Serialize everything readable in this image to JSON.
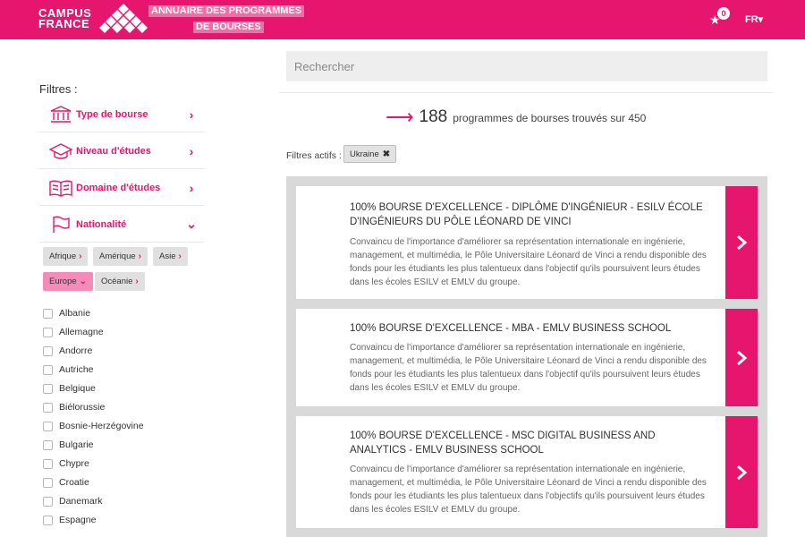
{
  "header": {
    "logo_line1": "CAMPUS",
    "logo_line2": "FRANCE",
    "tagline_line1": "ANNUAIRE DES PROGRAMMES",
    "tagline_line2": "DE BOURSES",
    "favorites_count": "0",
    "language": "FR▾",
    "brand_color": "#e6166e"
  },
  "sidebar": {
    "title": "Filtres :",
    "filters": [
      {
        "label": "Type de bourse",
        "icon": "institution-icon",
        "state": "collapsed"
      },
      {
        "label": "Niveau d'études",
        "icon": "graduation-cap-icon",
        "state": "collapsed"
      },
      {
        "label": "Domaine d'études",
        "icon": "book-icon",
        "state": "collapsed"
      },
      {
        "label": "Nationalité",
        "icon": "flag-icon",
        "state": "expanded"
      }
    ],
    "regions": [
      {
        "label": "Afrique",
        "active": false
      },
      {
        "label": "Amérique",
        "active": false
      },
      {
        "label": "Asie",
        "active": false
      },
      {
        "label": "Europe",
        "active": true
      },
      {
        "label": "Océanie",
        "active": false
      }
    ],
    "countries": [
      "Albanie",
      "Allemagne",
      "Andorre",
      "Autriche",
      "Belgique",
      "Biélorussie",
      "Bosnie-Herzégovine",
      "Bulgarie",
      "Chypre",
      "Croatie",
      "Danemark",
      "Espagne"
    ]
  },
  "main": {
    "search_placeholder": "Rechercher",
    "results_count": "188",
    "results_text": "programmes de bourses trouvés sur 450",
    "active_filters_label": "Filtres actifs :",
    "active_filters": [
      "Ukraine"
    ],
    "cards": [
      {
        "title": "100% BOURSE D'EXCELLENCE - DIPLÔME D'INGÉNIEUR - ESILV ÉCOLE D'INGÉNIEURS DU PÔLE LÉONARD DE VINCI",
        "description": "Convaincu de l'importance d'améliorer sa représentation internationale en ingénierie, management, et multimédia, le Pôle Universitaire Léonard de Vinci a rendu disponible des fonds pour les étudiants les plus talentueux dans l'objectif qu'ils poursuivent leurs études dans les écoles ESILV et EMLV du groupe."
      },
      {
        "title": "100% BOURSE D'EXCELLENCE - MBA - EMLV BUSINESS SCHOOL",
        "description": "Convaincu de l'importance d'améliorer sa représentation internationale en ingénierie, management, et multimédia, le Pôle Universitaire Léonard de Vinci a rendu disponible des fonds pour les étudiants les plus talentueux dans l'objectif qu'ils poursuivent leurs études dans les écoles ESILV et EMLV du groupe."
      },
      {
        "title": "100% BOURSE D'EXCELLENCE - MSC DIGITAL BUSINESS AND ANALYTICS - EMLV BUSINESS SCHOOL",
        "description": "Convaincu de l'importance d'améliorer sa représentation internationale en ingénierie, management, et multimédia, le Pôle Universitaire Léonard de Vinci a rendu disponible des fonds pour les étudiants les plus talentueux dans l'objectifs qu'ils poursuivent leurs études dans les écoles ESILV et EMLV du groupe."
      }
    ]
  }
}
